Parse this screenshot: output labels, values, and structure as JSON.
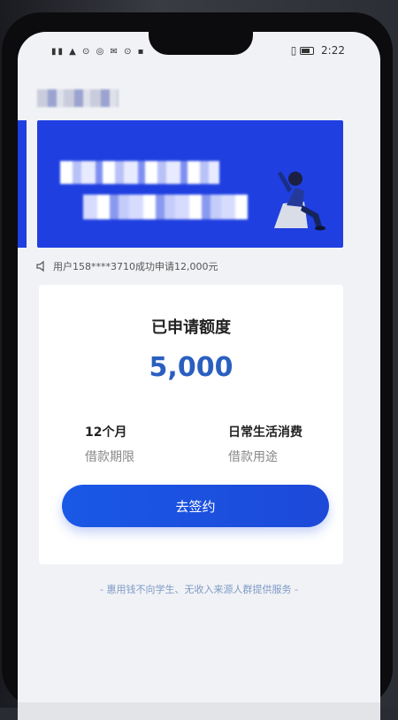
{
  "status_bar": {
    "left_icons": "▮▮ ▲ ⊙ ◎ ✉ ⊙ ▪",
    "vibrate_icon": "▯",
    "time": "2:22"
  },
  "ticker": {
    "text": "用户158****3710成功申请12,000元"
  },
  "card": {
    "title": "已申请额度",
    "amount": "5,000",
    "term_value": "12个月",
    "term_label": "借款期限",
    "purpose_value": "日常生活消费",
    "purpose_label": "借款用途",
    "sign_button_label": "去签约"
  },
  "footer": {
    "note": "- 惠用钱不向学生、无收入来源人群提供服务 -"
  },
  "colors": {
    "banner_blue": "#1f3fe0",
    "amount_blue": "#2a5fc0",
    "button_blue": "#1a58e6",
    "footer_blue": "#7e9ac8"
  },
  "icons": [
    "speaker-icon",
    "battery-icon",
    "vibrate-icon"
  ]
}
